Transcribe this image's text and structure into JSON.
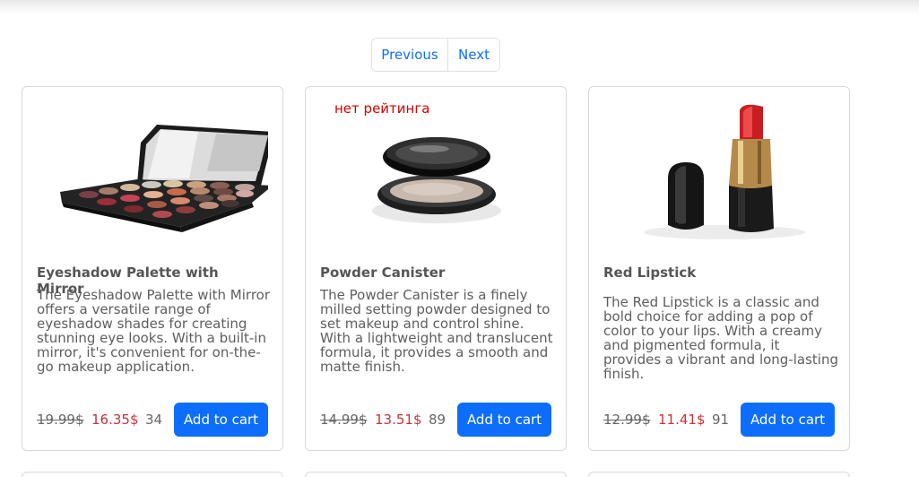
{
  "pagination": {
    "previous": "Previous",
    "next": "Next"
  },
  "products": [
    {
      "title": "Eyeshadow Palette with Mirror",
      "description": "The Eyeshadow Palette with Mirror offers a versatile range of eyeshadow shades for creating stunning eye looks. With a built-in mirror, it's convenient for on-the-go makeup application.",
      "old_price": "19.99$",
      "new_price": "16.35$",
      "count": "34",
      "button": "Add to cart",
      "image_icon": "eyeshadow-palette"
    },
    {
      "rating_note": "нет рейтинга",
      "title": "Powder Canister",
      "description": "The Powder Canister is a finely milled setting powder designed to set makeup and control shine. With a lightweight and translucent formula, it provides a smooth and matte finish.",
      "old_price": "14.99$",
      "new_price": "13.51$",
      "count": "89",
      "button": "Add to cart",
      "image_icon": "powder-compact"
    },
    {
      "title": "Red Lipstick",
      "description": "The Red Lipstick is a classic and bold choice for adding a pop of color to your lips. With a creamy and pigmented formula, it provides a vibrant and long-lasting finish.",
      "old_price": "12.99$",
      "new_price": "11.41$",
      "count": "91",
      "button": "Add to cart",
      "image_icon": "lipstick"
    }
  ],
  "colors": {
    "accent": "#0d6efd",
    "sale_price": "#c8323a",
    "no_rating": "#d40000"
  }
}
